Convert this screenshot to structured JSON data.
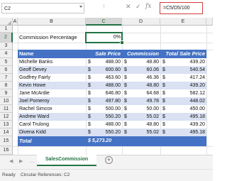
{
  "formula_bar": {
    "name_box": "C2",
    "dots": "⋮",
    "cancel_icon": "✕",
    "confirm_icon": "✓",
    "fx_label": "fx",
    "formula": "=C5/D5/100"
  },
  "columns": [
    "A",
    "B",
    "C",
    "D",
    "E"
  ],
  "rows": [
    "1",
    "2",
    "3",
    "4",
    "5",
    "6",
    "7",
    "8",
    "9",
    "10",
    "11",
    "12",
    "13",
    "14",
    "15",
    "16"
  ],
  "commission": {
    "label": "Commission Percentage",
    "value": "0%"
  },
  "table": {
    "headers": [
      "Name",
      "Sale Price",
      "Commission",
      "Total Sale Price"
    ],
    "rows": [
      {
        "name": "Michelle Banks",
        "sale": "488.00",
        "comm": "48.80",
        "total": "439.20"
      },
      {
        "name": "Geoff Devey",
        "sale": "600.60",
        "comm": "60.06",
        "total": "540.54"
      },
      {
        "name": "Godfrey Fairly",
        "sale": "463.60",
        "comm": "46.36",
        "total": "417.24"
      },
      {
        "name": "Kevin Howe",
        "sale": "488.00",
        "comm": "48.80",
        "total": "439.20"
      },
      {
        "name": "Jane McArdie",
        "sale": "646.80",
        "comm": "64.68",
        "total": "582.12"
      },
      {
        "name": "Joel Pomeroy",
        "sale": "497.80",
        "comm": "49.78",
        "total": "448.02"
      },
      {
        "name": "Rachel Simcox",
        "sale": "500.00",
        "comm": "50.00",
        "total": "450.00"
      },
      {
        "name": "Andrew Ward",
        "sale": "550.20",
        "comm": "55.02",
        "total": "495.18"
      },
      {
        "name": "Carol Trulong",
        "sale": "488.00",
        "comm": "48.80",
        "total": "439.20"
      },
      {
        "name": "Divena Kidd",
        "sale": "550.20",
        "comm": "55.02",
        "total": "495.18"
      }
    ],
    "currency": "$",
    "total_label": "Total",
    "total_value": "$ 5,273.20"
  },
  "tabs": {
    "prev": "◀",
    "next": "▶",
    "dots": "…",
    "sheet": "SalesCommission",
    "add": "+"
  },
  "status": {
    "ready": "Ready",
    "circular": "Circular References: C2"
  },
  "colors": {
    "header_blue": "#4472c4",
    "band_blue": "#d9e1f2",
    "excel_green": "#217346",
    "formula_border": "#d23b3b"
  }
}
